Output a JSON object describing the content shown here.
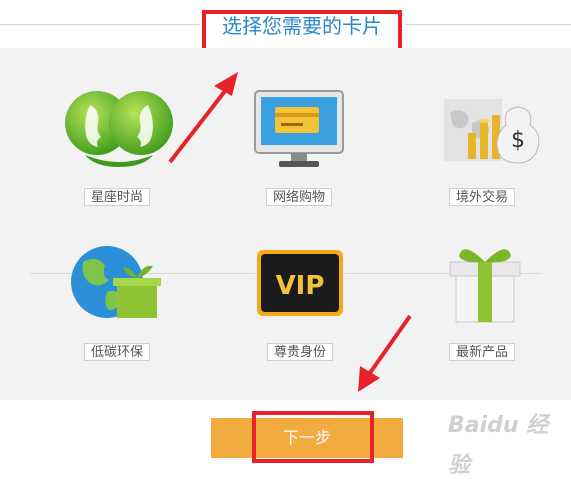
{
  "header": {
    "title": "选择您需要的卡片"
  },
  "cards": [
    {
      "label": "星座时尚",
      "icon": "gemini-zodiac-icon"
    },
    {
      "label": "网络购物",
      "icon": "computer-card-icon"
    },
    {
      "label": "境外交易",
      "icon": "world-money-icon"
    },
    {
      "label": "低碳环保",
      "icon": "eco-globe-icon"
    },
    {
      "label": "尊贵身份",
      "icon": "vip-card-icon"
    },
    {
      "label": "最新产品",
      "icon": "gift-box-icon"
    }
  ],
  "footer": {
    "next_label": "下一步",
    "watermark": "Baidu 经验"
  },
  "colors": {
    "accent_orange": "#f1ab3f",
    "title_blue": "#2a88c9",
    "highlight_red": "#e8212b"
  }
}
